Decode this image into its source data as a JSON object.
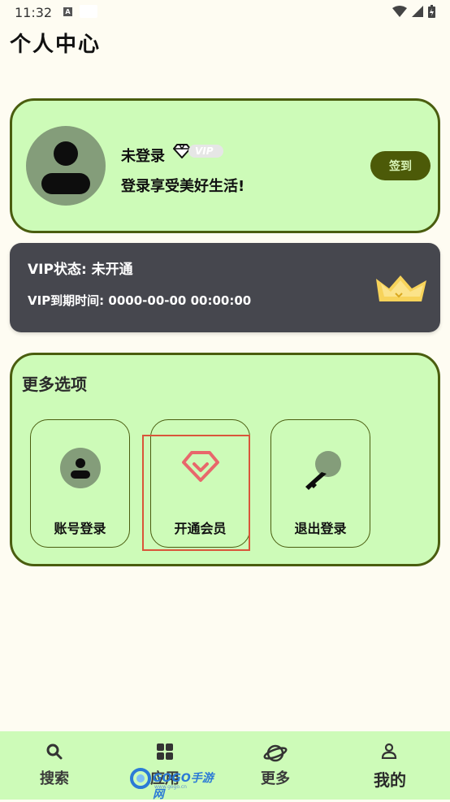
{
  "status_bar": {
    "time": "11:32",
    "a_icon": "A"
  },
  "page": {
    "title": "个人中心"
  },
  "profile": {
    "name": "未登录",
    "vip_badge": "VIP",
    "slogan": "登录享受美好生活!",
    "checkin_label": "签到"
  },
  "vip_card": {
    "status": "VIP状态: 未开通",
    "expire": "VIP到期时间: 0000-00-00 00:00:00"
  },
  "more": {
    "title": "更多选项",
    "options": [
      {
        "label": "账号登录",
        "icon": "user-icon"
      },
      {
        "label": "开通会员",
        "icon": "diamond-icon"
      },
      {
        "label": "退出登录",
        "icon": "key-icon"
      }
    ]
  },
  "nav": {
    "items": [
      {
        "label": "搜索",
        "icon": "search-icon"
      },
      {
        "label": "应用",
        "icon": "apps-icon"
      },
      {
        "label": "更多",
        "icon": "planet-icon"
      },
      {
        "label": "我的",
        "icon": "person-icon",
        "active": true
      }
    ]
  },
  "watermark": {
    "text": "GOGO手游网",
    "sub": "www.gogo.cn"
  },
  "colors": {
    "card_green": "#cdfbb8",
    "dark_olive": "#4a5d0f",
    "vip_card": "#46474e",
    "accent_red": "#e8676b",
    "page_bg": "#fefcf2"
  }
}
